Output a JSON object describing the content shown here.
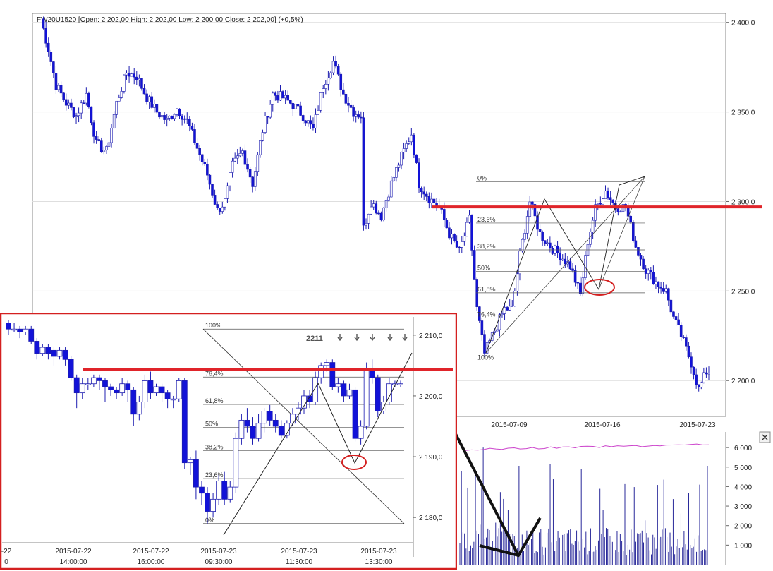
{
  "chart_data": [
    {
      "type": "candlestick",
      "title": "FW20U1520 [Open: 2 202,00  High: 2 202,00  Low: 2 200,00  Close: 2 202,00] (+0,5%)",
      "ylim": [
        2180,
        2405
      ],
      "y_ticks": [
        "2 400,0",
        "2 350,0",
        "2 300,0",
        "2 250,0",
        "2 200,0"
      ],
      "y_tick_values": [
        2400,
        2350,
        2300,
        2250,
        2200
      ],
      "x_ticks": [
        "2015-07-09",
        "2015-07-16",
        "2015-07-23"
      ],
      "grid": true,
      "price_anchors": [
        [
          0,
          2402
        ],
        [
          3,
          2385
        ],
        [
          6,
          2365
        ],
        [
          10,
          2355
        ],
        [
          14,
          2348
        ],
        [
          18,
          2360
        ],
        [
          22,
          2332
        ],
        [
          26,
          2328
        ],
        [
          30,
          2355
        ],
        [
          34,
          2372
        ],
        [
          38,
          2370
        ],
        [
          42,
          2358
        ],
        [
          46,
          2350
        ],
        [
          50,
          2345
        ],
        [
          54,
          2352
        ],
        [
          58,
          2345
        ],
        [
          62,
          2330
        ],
        [
          66,
          2315
        ],
        [
          70,
          2295
        ],
        [
          73,
          2300
        ],
        [
          76,
          2320
        ],
        [
          80,
          2328
        ],
        [
          84,
          2310
        ],
        [
          88,
          2340
        ],
        [
          92,
          2360
        ],
        [
          96,
          2358
        ],
        [
          100,
          2354
        ],
        [
          104,
          2348
        ],
        [
          108,
          2340
        ],
        [
          112,
          2365
        ],
        [
          116,
          2378
        ],
        [
          120,
          2360
        ],
        [
          124,
          2350
        ],
        [
          127,
          2348
        ],
        [
          128,
          2285
        ],
        [
          131,
          2300
        ],
        [
          135,
          2292
        ],
        [
          139,
          2310
        ],
        [
          143,
          2325
        ],
        [
          147,
          2338
        ],
        [
          150,
          2310
        ],
        [
          154,
          2302
        ],
        [
          158,
          2297
        ],
        [
          162,
          2282
        ],
        [
          166,
          2272
        ],
        [
          170,
          2290
        ],
        [
          173,
          2240
        ],
        [
          176,
          2215
        ],
        [
          180,
          2228
        ],
        [
          184,
          2240
        ],
        [
          187,
          2240
        ],
        [
          190,
          2270
        ],
        [
          194,
          2300
        ],
        [
          198,
          2282
        ],
        [
          202,
          2275
        ],
        [
          206,
          2270
        ],
        [
          210,
          2264
        ],
        [
          214,
          2248
        ],
        [
          217,
          2278
        ],
        [
          220,
          2296
        ],
        [
          224,
          2306
        ],
        [
          228,
          2297
        ],
        [
          232,
          2297
        ],
        [
          236,
          2275
        ],
        [
          240,
          2262
        ],
        [
          244,
          2255
        ],
        [
          248,
          2250
        ],
        [
          251,
          2235
        ],
        [
          254,
          2225
        ],
        [
          258,
          2210
        ],
        [
          261,
          2195
        ],
        [
          264,
          2205
        ]
      ],
      "fibonacci": {
        "levels": [
          "0%",
          "23,6%",
          "38,2%",
          "50%",
          "61,8%",
          "76,4%",
          "100%"
        ],
        "prices": [
          2311,
          2288,
          2273,
          2261,
          2249,
          2235,
          2211
        ]
      },
      "horizontal_line": 2297,
      "volume": {
        "y_ticks": [
          "6 000",
          "5 000",
          "4 000",
          "3 000",
          "2 000",
          "1 000"
        ],
        "y_tick_values": [
          6000,
          5000,
          4000,
          3000,
          2000,
          1000
        ],
        "ylim": [
          0,
          6800
        ]
      }
    },
    {
      "type": "candlestick",
      "ylim": [
        2177,
        2213
      ],
      "y_ticks": [
        "2 210,0",
        "2 200,0",
        "2 190,0",
        "2 180,0"
      ],
      "y_tick_values": [
        2210,
        2200,
        2190,
        2180
      ],
      "x_ticks": [
        [
          "-22",
          "0"
        ],
        [
          "2015-07-22",
          "14:00:00"
        ],
        [
          "2015-07-22",
          "16:00:00"
        ],
        [
          "2015-07-23",
          "09:30:00"
        ],
        [
          "2015-07-23",
          "11:30:00"
        ],
        [
          "2015-07-23",
          "13:30:00"
        ]
      ],
      "candles": [
        [
          2212,
          2211,
          2212.5,
          2210
        ],
        [
          2211,
          2211,
          2212,
          2210.5
        ],
        [
          2211,
          2210.5,
          2211.5,
          2209.5
        ],
        [
          2210.5,
          2211,
          2211.5,
          2210
        ],
        [
          2211,
          2209,
          2211.5,
          2208.5
        ],
        [
          2209,
          2207,
          2209.5,
          2206
        ],
        [
          2207,
          2208,
          2208.5,
          2206.5
        ],
        [
          2208,
          2207,
          2208.5,
          2206
        ],
        [
          2207.5,
          2206.5,
          2208,
          2205
        ],
        [
          2206.5,
          2207.5,
          2208,
          2206
        ],
        [
          2207.5,
          2206,
          2208,
          2205
        ],
        [
          2206,
          2203,
          2206.5,
          2202.5
        ],
        [
          2203,
          2200.5,
          2203.5,
          2198
        ],
        [
          2200.5,
          2202,
          2203,
          2199.5
        ],
        [
          2202,
          2202,
          2203,
          2201
        ],
        [
          2202,
          2203,
          2203.5,
          2201.5
        ],
        [
          2203,
          2202.5,
          2203.5,
          2201
        ],
        [
          2202.5,
          2201.5,
          2203,
          2199
        ],
        [
          2201.5,
          2201,
          2202,
          2200
        ],
        [
          2201,
          2200.5,
          2201.5,
          2199.5
        ],
        [
          2200.5,
          2202,
          2203,
          2200
        ],
        [
          2202,
          2201,
          2202.5,
          2199
        ],
        [
          2201,
          2197,
          2201.5,
          2195
        ],
        [
          2197,
          2199,
          2200,
          2196
        ],
        [
          2199,
          2202.5,
          2203.5,
          2198
        ],
        [
          2202.5,
          2200.5,
          2204,
          2199.5
        ],
        [
          2200.5,
          2201.5,
          2202,
          2200
        ],
        [
          2201.5,
          2200.5,
          2202,
          2199
        ],
        [
          2200.5,
          2199.5,
          2201,
          2198
        ],
        [
          2199.5,
          2199.5,
          2200,
          2198
        ],
        [
          2199.5,
          2202.5,
          2203,
          2199
        ],
        [
          2202.5,
          2189,
          2203,
          2188
        ],
        [
          2189,
          2189.5,
          2190,
          2187
        ],
        [
          2189.5,
          2185,
          2191,
          2183
        ],
        [
          2185,
          2184,
          2186,
          2182
        ],
        [
          2184,
          2181,
          2185,
          2179
        ],
        [
          2181,
          2183,
          2184,
          2180
        ],
        [
          2183,
          2186,
          2187,
          2182
        ],
        [
          2186,
          2183,
          2187.5,
          2182
        ],
        [
          2183,
          2185,
          2186,
          2182.5
        ],
        [
          2185,
          2193,
          2194,
          2184
        ],
        [
          2193,
          2196,
          2197,
          2192
        ],
        [
          2196,
          2195,
          2198,
          2194
        ],
        [
          2195,
          2193,
          2196.5,
          2192
        ],
        [
          2193,
          2195.5,
          2197,
          2192.5
        ],
        [
          2195.5,
          2197.5,
          2198,
          2194
        ],
        [
          2197.5,
          2196,
          2198.5,
          2195
        ],
        [
          2196,
          2195,
          2197,
          2194
        ],
        [
          2195,
          2193.5,
          2196,
          2193
        ],
        [
          2193.5,
          2195.5,
          2196,
          2193
        ],
        [
          2195.5,
          2197,
          2198,
          2195
        ],
        [
          2197,
          2198,
          2199,
          2196
        ],
        [
          2198,
          2200,
          2201,
          2197
        ],
        [
          2200,
          2199,
          2201,
          2198
        ],
        [
          2199,
          2203,
          2204,
          2198.5
        ],
        [
          2203,
          2205,
          2205.5,
          2202
        ],
        [
          2205,
          2205.5,
          2206,
          2204
        ],
        [
          2205.5,
          2201.5,
          2206,
          2201
        ],
        [
          2201.5,
          2202,
          2203,
          2200.5
        ],
        [
          2202,
          2200,
          2202.5,
          2199
        ],
        [
          2200,
          2201,
          2202,
          2199.5
        ],
        [
          2201,
          2193,
          2201.5,
          2192.5
        ],
        [
          2193,
          2195,
          2196,
          2192
        ],
        [
          2195,
          2204.5,
          2205.5,
          2194.5
        ],
        [
          2204.5,
          2203,
          2206,
          2202
        ],
        [
          2203,
          2197.5,
          2203.5,
          2196.5
        ],
        [
          2197.5,
          2199,
          2200,
          2197
        ],
        [
          2199,
          2202,
          2203,
          2198.5
        ],
        [
          2202,
          2202,
          2202.5,
          2201.5
        ],
        [
          2202,
          2202,
          2202.5,
          2201.5
        ]
      ],
      "fibonacci": {
        "levels": [
          "100%",
          "76,4%",
          "61,8%",
          "50%",
          "38,2%",
          "23,6%",
          "0%"
        ],
        "prices": [
          2211,
          2203.1,
          2198.6,
          2194.8,
          2191,
          2186.4,
          2179
        ]
      },
      "horizontal_line": 2204.3,
      "badge": "2211"
    }
  ]
}
